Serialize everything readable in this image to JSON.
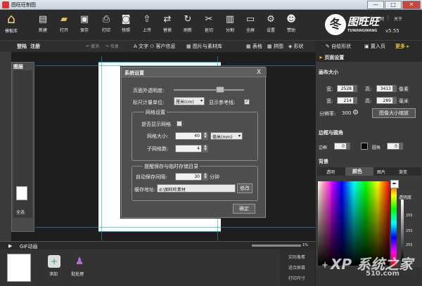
{
  "window": {
    "title": "图旺旺制图",
    "minimize": "—",
    "maximize": "□",
    "close": "✕"
  },
  "toolbar": {
    "items": [
      {
        "label": "模板库",
        "icon": "home-icon",
        "glyph": "⌂"
      },
      {
        "label": "新建",
        "icon": "new-file-icon",
        "glyph": "▤"
      },
      {
        "label": "打开",
        "icon": "open-folder-icon",
        "glyph": "▰"
      },
      {
        "label": "保存",
        "icon": "save-icon",
        "glyph": "▣"
      },
      {
        "label": "打印",
        "icon": "print-icon",
        "glyph": "⎙"
      },
      {
        "label": "快照",
        "icon": "camera-icon",
        "glyph": "◙"
      },
      {
        "label": "上传",
        "icon": "upload-icon",
        "glyph": "⇧"
      },
      {
        "label": "替换",
        "icon": "replace-icon",
        "glyph": "⇄"
      },
      {
        "label": "刷新",
        "icon": "refresh-icon",
        "glyph": "↻"
      },
      {
        "label": "抠切",
        "icon": "scissors-icon",
        "glyph": "✂"
      },
      {
        "label": "分割",
        "icon": "split-icon",
        "glyph": "▥"
      },
      {
        "label": "全屏",
        "icon": "monitor-icon",
        "glyph": "▭"
      },
      {
        "label": "设置",
        "icon": "gear-icon",
        "glyph": "⚙"
      },
      {
        "label": "赞助",
        "icon": "donate-icon",
        "glyph": "☻"
      }
    ],
    "links": {
      "tutorial": "教程",
      "website": "官网",
      "about": "关于"
    },
    "logo": {
      "brand": "图旺旺",
      "sub": "TUWANGWANG",
      "version": "v5.55"
    }
  },
  "bar2": {
    "login": "登陆",
    "register": "注册",
    "undo": "撤消",
    "redo": "恢复",
    "tools": [
      "文字",
      "客户信息",
      "图片与素材库",
      "表格",
      "拼图",
      "形状",
      "自绘形状",
      "置入页",
      "更多"
    ],
    "tool_glyphs": [
      "A",
      "⚇",
      "▦",
      "▦",
      "▦",
      "◈",
      "✎",
      "▣",
      ""
    ],
    "page_settings": "页面设置"
  },
  "left_panel": {
    "title": "图层",
    "select_all": "全选"
  },
  "right_panel": {
    "canvas_size_title": "画布大小",
    "width_label": "宽:",
    "width_px": "2528",
    "height_label": "高:",
    "height_px": "3413",
    "unit_px": "像素",
    "width_mm": "214",
    "height_mm": "289",
    "unit_mm": "毫米",
    "resolution_label": "分辨率:",
    "resolution": "300",
    "scale_button": "图像大小缩放",
    "border_title": "边框与圆角",
    "border_label": "边框",
    "border_value": "0",
    "radius_label": "圆角",
    "radius_value": "0",
    "background_title": "背景",
    "bg_tabs": [
      "透明",
      "颜色",
      "图片",
      "渐变"
    ],
    "transparency_label": "透明度",
    "alpha_values": [
      "255",
      "255",
      "255"
    ]
  },
  "dialog": {
    "title": "系统设置",
    "close": "X",
    "outer_transparency_label": "页面外透明度:",
    "ruler_unit_label": "标尺计量单位:",
    "ruler_unit_value": "厘米(cm)",
    "show_guides_label": "显示参考线:",
    "grid_group": "网格设置",
    "show_grid_label": "是否显示网格",
    "grid_size_label": "网格大小:",
    "grid_size_value": "40",
    "grid_unit_value": "毫米(mm)",
    "sub_grid_label": "子网格数:",
    "sub_grid_value": "4",
    "autosave_group": "提醒保存与临时存储目录",
    "autosave_label": "自动保存间隔:",
    "autosave_value": "30",
    "autosave_unit": "分钟",
    "cache_label": "缓存地址:",
    "cache_value": "d:\\图旺旺素材",
    "modify_button": "修改",
    "ok_button": "确定"
  },
  "bottom": {
    "gif_label": "GIF动画",
    "zoom": "1%",
    "add_label": "添加",
    "batch_label": "批处理",
    "side_items": [
      "实际像素",
      "适合屏幕",
      "打印尺寸"
    ]
  },
  "watermark": {
    "text": "XP 系统之家",
    "site": "510.com"
  },
  "colors": {
    "accent": "#1fa3c8",
    "panel": "#3b3b3b",
    "toolbar": "#2b2b2b"
  }
}
